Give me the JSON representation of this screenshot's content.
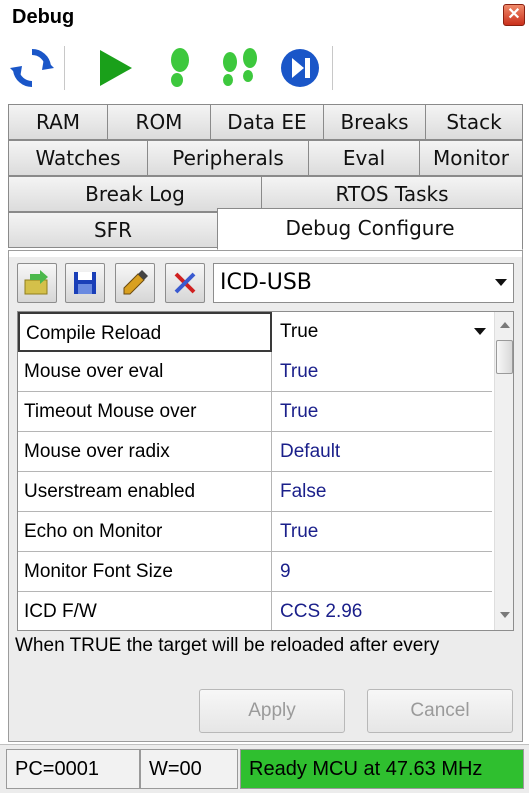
{
  "window": {
    "title": "Debug",
    "close_icon": "close-icon"
  },
  "toolbar": {
    "buttons": [
      {
        "name": "refresh",
        "icon": "refresh-icon",
        "color": "#1a56c8"
      },
      {
        "name": "run",
        "icon": "play-icon",
        "color": "#1aa01a"
      },
      {
        "name": "step-into",
        "icon": "footstep-icon",
        "color": "#2fbf2f"
      },
      {
        "name": "step-over",
        "icon": "footsteps-icon",
        "color": "#2fbf2f"
      },
      {
        "name": "run-to",
        "icon": "skip-forward-icon",
        "color": "#1a56c8"
      }
    ]
  },
  "tabs": {
    "row1": [
      "RAM",
      "ROM",
      "Data EE",
      "Breaks",
      "Stack"
    ],
    "row2": [
      "Watches",
      "Peripherals",
      "Eval",
      "Monitor"
    ],
    "row3": [
      "Break Log",
      "RTOS Tasks"
    ],
    "row4": [
      "SFR",
      "Debug Configure"
    ],
    "active": "Debug Configure"
  },
  "config_toolbar": {
    "buttons": [
      {
        "name": "load",
        "icon": "load-arrow-icon"
      },
      {
        "name": "save",
        "icon": "save-disk-icon"
      },
      {
        "name": "edit",
        "icon": "pencil-icon"
      },
      {
        "name": "clear",
        "icon": "clear-x-icon"
      }
    ],
    "device": "ICD-USB"
  },
  "properties": [
    {
      "name": "Compile Reload",
      "value": "True"
    },
    {
      "name": "Mouse over eval",
      "value": "True"
    },
    {
      "name": "Timeout Mouse over",
      "value": "True"
    },
    {
      "name": "Mouse over radix",
      "value": "Default"
    },
    {
      "name": "Userstream enabled",
      "value": "False"
    },
    {
      "name": "Echo on Monitor",
      "value": "True"
    },
    {
      "name": "Monitor Font Size",
      "value": "9"
    },
    {
      "name": "ICD F/W",
      "value": "CCS 2.96"
    }
  ],
  "description": "When TRUE the target will be reloaded after every",
  "buttons": {
    "apply": "Apply",
    "cancel": "Cancel"
  },
  "status": {
    "pc": "PC=0001",
    "w": "W=00",
    "message": "Ready MCU at 47.63 MHz",
    "message_color": "#2fbf2f"
  }
}
